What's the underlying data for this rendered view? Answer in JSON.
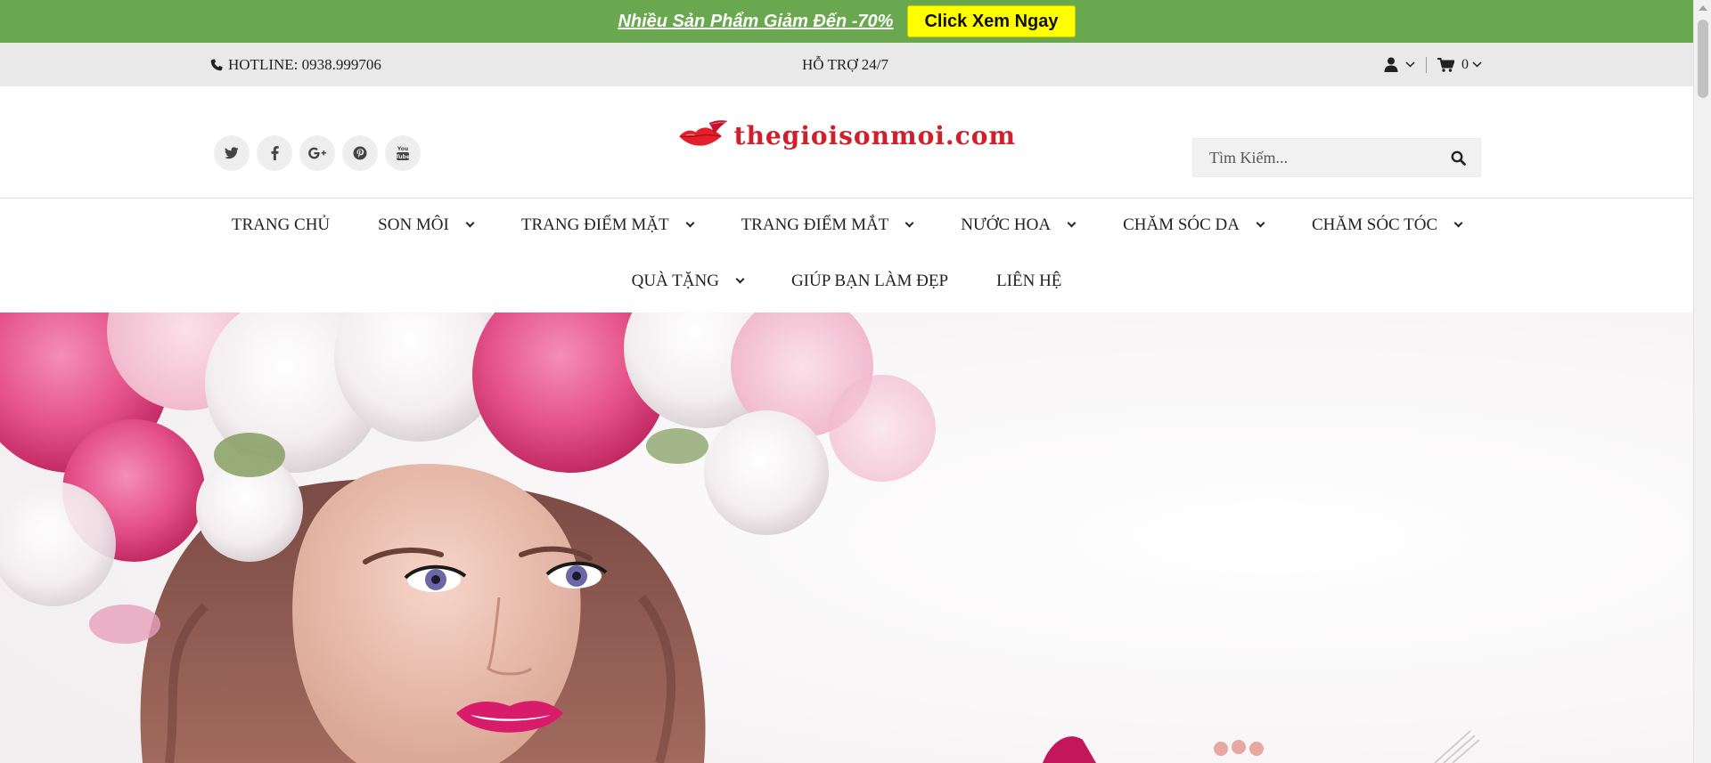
{
  "promo": {
    "text": "Nhiều Sản Phẩm Giảm Đến -70%",
    "button": "Click Xem Ngay",
    "bg_color": "#6aa84f",
    "button_color": "#ffff00"
  },
  "topbar": {
    "hotline": "HOTLINE: 0938.999706",
    "support": "HỖ TRỢ 24/7",
    "cart_count": "0"
  },
  "header": {
    "social_icons": [
      "twitter-icon",
      "facebook-icon",
      "google-plus-icon",
      "pinterest-icon",
      "youtube-icon"
    ],
    "logo_text": "thegioisonmoi.com",
    "search_placeholder": "Tìm Kiếm..."
  },
  "nav": {
    "row1": [
      {
        "label": "TRANG CHỦ",
        "dropdown": false
      },
      {
        "label": "SON MÔI",
        "dropdown": true
      },
      {
        "label": "TRANG ĐIỂM MẶT",
        "dropdown": true
      },
      {
        "label": "TRANG ĐIỂM MẮT",
        "dropdown": true
      },
      {
        "label": "NƯỚC HOA",
        "dropdown": true
      },
      {
        "label": "CHĂM SÓC DA",
        "dropdown": true
      },
      {
        "label": "CHĂM SÓC TÓC",
        "dropdown": true
      }
    ],
    "row2": [
      {
        "label": "QUÀ TẶNG",
        "dropdown": true
      },
      {
        "label": "GIÚP BẠN LÀM ĐẸP",
        "dropdown": false
      },
      {
        "label": "LIÊN HỆ",
        "dropdown": false
      }
    ]
  },
  "colors": {
    "accent_red": "#d11f2c",
    "topbar_bg": "#e9e9e9"
  }
}
